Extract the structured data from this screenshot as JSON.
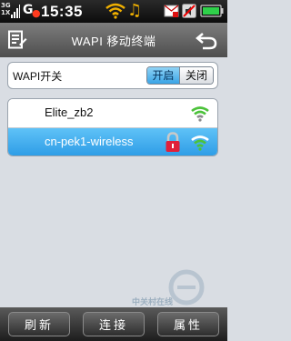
{
  "status_bar": {
    "network_top": "3G",
    "network_bottom": "1X",
    "carrier_letter": "G",
    "time": "15:35",
    "icons": [
      "signal-bars-icon",
      "alarm-icon",
      "wifi-icon",
      "music-note-icon",
      "message-icon",
      "ringer-icon",
      "battery-icon"
    ],
    "accent_colors": {
      "music": "#f0b000",
      "alarm": "#ff3b1f",
      "battery": "#2fd04a"
    }
  },
  "header": {
    "title": "WAPI 移动终端",
    "icons": [
      "menu-icon",
      "back-icon"
    ]
  },
  "wapi_switch": {
    "label": "WAPI开关",
    "on_label": "开启",
    "off_label": "关闭",
    "selected": "开启"
  },
  "networks": [
    {
      "name": "Elite_zb2",
      "secured": false,
      "selected": false
    },
    {
      "name": "cn-pek1-wireless",
      "secured": true,
      "selected": true
    }
  ],
  "watermark": "中关村在线",
  "bottom_bar": {
    "refresh": "刷新",
    "connect": "连接",
    "properties": "属性"
  },
  "colors": {
    "selection_blue": "#3aa4e6",
    "lock_red": "#e0203a",
    "wifi_green": "#4cc23a"
  }
}
